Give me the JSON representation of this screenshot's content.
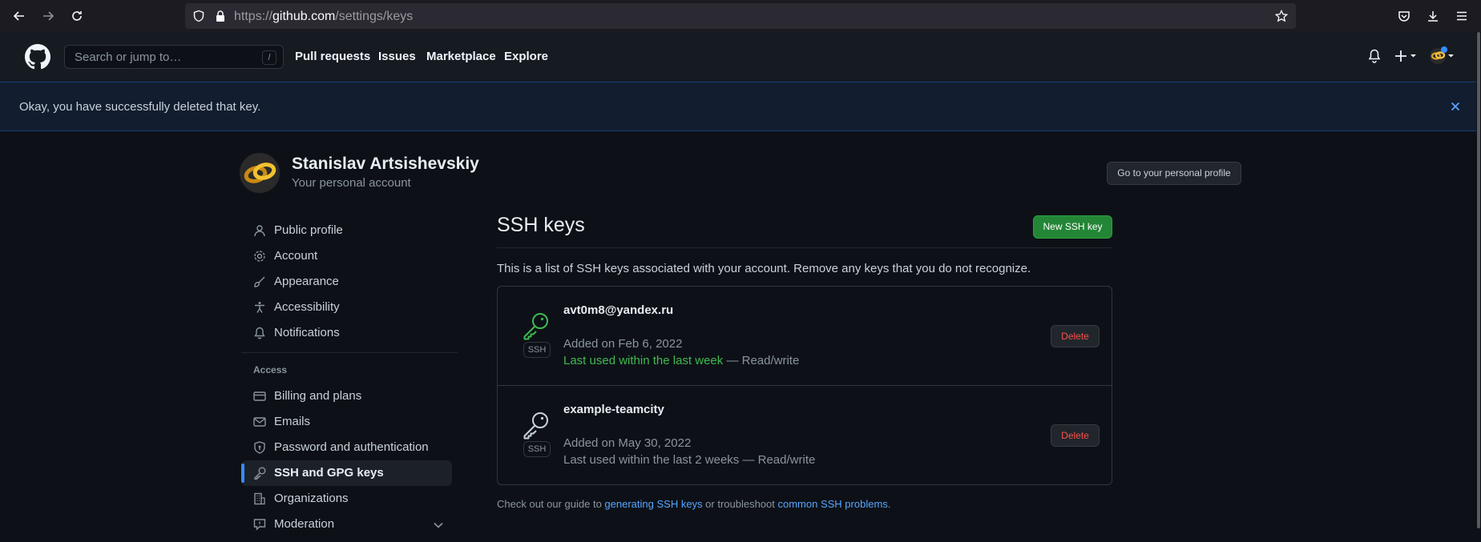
{
  "browser": {
    "url_prefix": "https://",
    "url_domain": "github.com",
    "url_path": "/settings/keys"
  },
  "header": {
    "search_placeholder": "Search or jump to…",
    "search_shortcut": "/",
    "nav": [
      "Pull requests",
      "Issues",
      "Marketplace",
      "Explore"
    ]
  },
  "flash": {
    "message": "Okay, you have successfully deleted that key."
  },
  "profile": {
    "name": "Stanislav Artsishevskiy",
    "subtitle": "Your personal account",
    "profile_button": "Go to your personal profile"
  },
  "sidebar": {
    "items": [
      {
        "label": "Public profile",
        "icon": "person-icon"
      },
      {
        "label": "Account",
        "icon": "gear-icon"
      },
      {
        "label": "Appearance",
        "icon": "paintbrush-icon"
      },
      {
        "label": "Accessibility",
        "icon": "accessibility-icon"
      },
      {
        "label": "Notifications",
        "icon": "bell-icon"
      }
    ],
    "access_heading": "Access",
    "access_items": [
      {
        "label": "Billing and plans",
        "icon": "credit-card-icon"
      },
      {
        "label": "Emails",
        "icon": "mail-icon"
      },
      {
        "label": "Password and authentication",
        "icon": "shield-lock-icon"
      },
      {
        "label": "SSH and GPG keys",
        "icon": "key-icon",
        "selected": true
      },
      {
        "label": "Organizations",
        "icon": "organization-icon"
      },
      {
        "label": "Moderation",
        "icon": "report-icon"
      }
    ]
  },
  "main": {
    "title": "SSH keys",
    "new_button": "New SSH key",
    "description": "This is a list of SSH keys associated with your account. Remove any keys that you do not recognize.",
    "keys": [
      {
        "title": "avt0m8@yandex.ru",
        "badge": "SSH",
        "added": "Added on Feb 6, 2022",
        "last_used": "Last used within the last week",
        "access": " — Read/write",
        "delete_label": "Delete",
        "recent": true
      },
      {
        "title": "example-teamcity",
        "badge": "SSH",
        "added": "Added on May 30, 2022",
        "last_used": "Last used within the last 2 weeks",
        "access": " — Read/write",
        "delete_label": "Delete",
        "recent": false
      }
    ],
    "footer": {
      "prefix": "Check out our guide to ",
      "link1": "generating SSH keys",
      "middle": " or troubleshoot ",
      "link2": "common SSH problems",
      "suffix": "."
    }
  },
  "colors": {
    "accent": "#238636",
    "link": "#58a6ff",
    "danger": "#f85149",
    "recent_key": "#3fb950"
  }
}
